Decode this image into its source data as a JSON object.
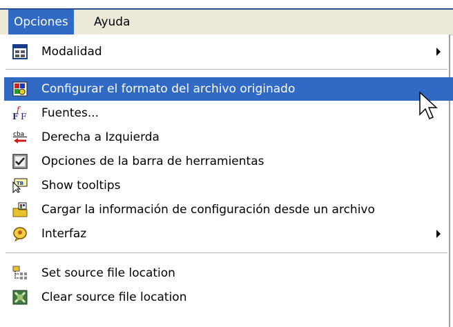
{
  "menubar": {
    "items": [
      {
        "label": "Opciones",
        "active": true
      },
      {
        "label": "Ayuda",
        "active": false
      }
    ]
  },
  "menu": {
    "items": [
      {
        "label": "Modalidad",
        "icon": "window-icon",
        "submenu": true
      },
      {
        "label": "Configurar el formato del archivo originado",
        "icon": "palette-icon",
        "highlighted": true
      },
      {
        "label": "Fuentes...",
        "icon": "fonts-icon"
      },
      {
        "label": "Derecha a Izquierda",
        "icon": "rtl-arrow-icon",
        "icon_text": "cba"
      },
      {
        "label": "Opciones de la barra de herramientas",
        "icon": "toolbar-check-icon"
      },
      {
        "label": "Show tooltips",
        "icon": "tooltip-icon",
        "icon_text": "TB"
      },
      {
        "label": "Cargar la información de configuración desde un archivo",
        "icon": "load-config-icon"
      },
      {
        "label": "Interfaz",
        "icon": "interface-icon",
        "submenu": true
      },
      {
        "label": "Set source file location",
        "icon": "source-tree-icon"
      },
      {
        "label": "Clear source file location",
        "icon": "clear-location-icon"
      }
    ]
  },
  "colors": {
    "highlight": "#316ac5",
    "menubar_bg": "#ece9d8",
    "top_border": "#2a4f8f"
  }
}
